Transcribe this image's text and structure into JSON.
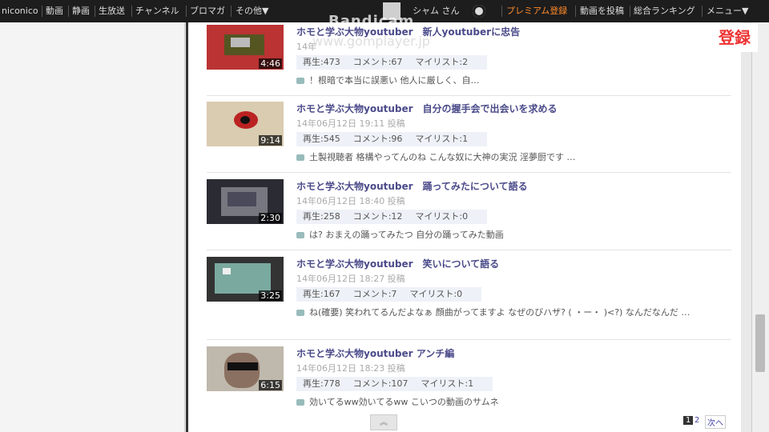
{
  "nav": {
    "logo": "niconico",
    "items": [
      "動画",
      "静画",
      "生放送",
      "チャンネル",
      "ブロマガ",
      "その他▼"
    ],
    "user": "シャム さん",
    "premium": "プレミアム登録",
    "post": "動画を投稿",
    "ranking": "総合ランキング",
    "menu": "メニュー▼"
  },
  "overlay": {
    "register": "登録",
    "watermark": "Bandicam",
    "watermark_url": "www.gomplayer.jp"
  },
  "videos": [
    {
      "title": "ホモと学ぶ大物youtuber　新人youtuberに忠告",
      "date": "14年",
      "duration": "4:46",
      "views": "再生:473",
      "comments": "コメント:67",
      "mylist": "マイリスト:2",
      "comment_text": "！根暗で本当に誤悪い 他人に厳しく、自…"
    },
    {
      "title": "ホモと学ぶ大物youtuber　自分の握手会で出会いを求める",
      "date": "14年06月12日 19:11 投稿",
      "duration": "9:14",
      "views": "再生:545",
      "comments": "コメント:96",
      "mylist": "マイリスト:1",
      "comment_text": "土製視聴者 格構やってんのね こんな奴に大神の実況 淫夢厨です …"
    },
    {
      "title": "ホモと学ぶ大物youtuber　踊ってみたについて語る",
      "date": "14年06月12日 18:40 投稿",
      "duration": "2:30",
      "views": "再生:258",
      "comments": "コメント:12",
      "mylist": "マイリスト:0",
      "comment_text": "は? おまえの踊ってみたつ 自分の踊ってみた動画"
    },
    {
      "title": "ホモと学ぶ大物youtuber　笑いについて語る",
      "date": "14年06月12日 18:27 投稿",
      "duration": "3:25",
      "views": "再生:167",
      "comments": "コメント:7",
      "mylist": "マイリスト:0",
      "comment_text": "ね(確要) 笑われてるんだよなぁ 顔曲がってますよ なぜのびハザ? ( ・ー・ )<?) なんだなんだ …"
    },
    {
      "title": "ホモと学ぶ大物youtuber アンチ編",
      "date": "14年06月12日 18:23 投稿",
      "duration": "6:15",
      "views": "再生:778",
      "comments": "コメント:107",
      "mylist": "マイリスト:1",
      "comment_text": "効いてるww効いてるww こいつの動画のサムネ"
    }
  ],
  "pager": {
    "page1": "1",
    "page2": "2",
    "next": "次へ",
    "up": "︽"
  }
}
